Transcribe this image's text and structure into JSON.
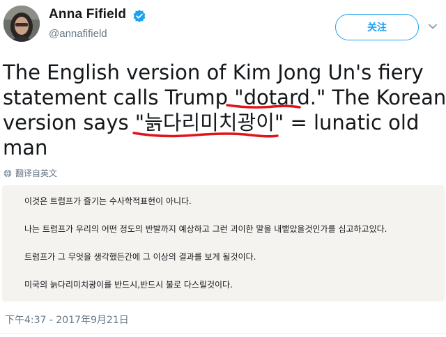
{
  "author": {
    "name": "Anna Fifield",
    "handle": "@annafifield"
  },
  "follow_button": {
    "label": "关注"
  },
  "tweet": {
    "lines": [
      "The English version of Kim Jong Un's fiery",
      "statement calls Trump \"dotard.\" The Korean",
      "version says \"늙다리미치광이\" = lunatic old",
      "man"
    ]
  },
  "translate": {
    "label": "翻译自英文"
  },
  "translation": {
    "lines": [
      "이것은 트럼프가 즐기는 수사학적표현이 아니다.",
      "나는 트럼프가 우리의 어떤 정도의 반발까지 예상하고 그런 괴이한 말을 내뱉았을것인가를 심고하고있다.",
      "트럼프가 그 무엇을 생각했든간에 그 이상의 결과를 보게 될것이다.",
      "미국의 늙다리미치광이를 반드시,반드시 불로 다스릴것이다."
    ]
  },
  "timestamp": "下午4:37 - 2017年9月21日",
  "colors": {
    "accent": "#1da1f2",
    "annotation": "#e0141c",
    "panel": "#f5f3f0"
  },
  "icons": [
    "verified-badge-icon",
    "chevron-down-icon",
    "globe-icon"
  ]
}
